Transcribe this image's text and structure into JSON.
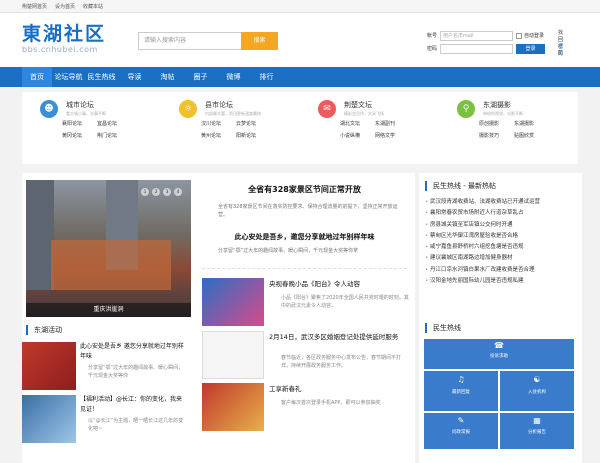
{
  "topbar": [
    "荆楚网首页",
    "设为首页",
    "收藏本站"
  ],
  "logo": {
    "cn": "東湖社区",
    "url": "bbs.cnhubei.com"
  },
  "search": {
    "placeholder": "请输入搜索内容",
    "button": "搜索"
  },
  "login": {
    "account_label": "帐号",
    "account_placeholder": "用户名/Email",
    "auto_login": "自动登录",
    "find_password": "找回密码",
    "password_label": "密码",
    "login_button": "登录",
    "register": "注册"
  },
  "nav": [
    "首页",
    "论坛导航",
    "民生热线",
    "导读",
    "淘帖",
    "圈子",
    "微博",
    "排行"
  ],
  "forums": [
    {
      "title": "城市论坛",
      "sub": "看大城小事，光事不断",
      "icon": "person-icon",
      "color": "#3b8fd9",
      "links": [
        "襄阳论坛",
        "宜昌论坛",
        "黄冈论坛",
        "荆门论坛"
      ]
    },
    {
      "title": "县市论坛",
      "sub": "内部最丰富，资讯更新速度最快",
      "icon": "lightbulb-icon",
      "color": "#f0c02f",
      "links": [
        "汉川论坛",
        "云梦论坛",
        "黄州论坛",
        "阳新论坛"
      ]
    },
    {
      "title": "荆楚文坛",
      "sub": "精彩会员作，文采飞扬",
      "icon": "chat-icon",
      "color": "#ef5b5b",
      "links": [
        "湖北文坛",
        "东湖副刊",
        "小说纵横",
        "网络文学"
      ]
    },
    {
      "title": "东湖摄影",
      "sub": "带给你视觉，光影不断",
      "icon": "utensils-icon",
      "color": "#7ac142",
      "links": [
        "原创摄影",
        "东湖摄影",
        "摄影技巧",
        "贴图欣赏"
      ]
    }
  ],
  "banner": {
    "caption": "重庆洪崖洞",
    "dots": [
      "1",
      "2",
      "3",
      "4"
    ]
  },
  "headline": {
    "title": "全省有328家景区节间正常开放",
    "desc": "全省有328家景区节间在落实防控要求、保持合理流量的前提下，坚持正常开放运营。"
  },
  "headline2": {
    "title": "此心安处是吾乡，邀您分享就地过年别样年味",
    "desc": "分享留“鄂”过大年的趣闻故事、暖心瞬间，千元现金大奖等你拿"
  },
  "news": [
    {
      "title": "央视春晚小品《阳台》令人动容",
      "desc": "小品《阳台》聚焦了2020年全国人民共克时艰的时刻，其中的武汉元素令人动容。"
    },
    {
      "title": "2月14日，武汉多区婚姻登记处提供延时服务",
      "desc": "春节临近，各区政务服务中心发布公告，春节期间不打烊，持续开展政务服务工作。"
    },
    {
      "title": "工享新春礼",
      "desc": "客户每次首次登录手机APP，即可以参加抽奖"
    }
  ],
  "djsection": {
    "title": "东湖活动"
  },
  "djitems": [
    {
      "title": "此心安处是吾乡 邀您分享就地过年别样年味",
      "desc": "分享留“鄂”过大年的趣闻故事、暖心瞬间，千元现金大奖等你"
    },
    {
      "title": "【福利活动】@长江：你的变化，我来见证！",
      "desc": "以“@长江”为主题，晒一晒长江这几年的变化吧~"
    }
  ],
  "sidebar": {
    "hot_title": "民生热线 - 最新热帖",
    "hot_items": [
      "武汉段青湖收费站、法湖收费站已开通试运营",
      "襄阳常春农贸市场附近人行道杂草乱占",
      "房县城关镇至军店镇公交何时开通",
      "蔡甸区光华御江湾房屋验收是否合格",
      "咸宁嘉鱼县舒桥村六组挖鱼塘是否违规",
      "建议襄城区南湖路边增加健身器材",
      "丹江口凉水河镇白果水厂改建收费是否合理",
      "汉阳金地先丽国际幼儿园是否违规私建"
    ],
    "hotline_title": "民生热线",
    "tiles": [
      {
        "label": "投诉求助",
        "icon": "megaphone-icon"
      },
      {
        "label": "最新回复",
        "icon": "bell-icon"
      },
      {
        "label": "入驻机构",
        "icon": "person-badge-icon"
      },
      {
        "label": "问政常报",
        "icon": "chat-bubble-icon"
      },
      {
        "label": "分析报告",
        "icon": "grid-icon"
      }
    ]
  },
  "colors": {
    "brand": "#1a6fc4",
    "accent": "#f5a623"
  }
}
